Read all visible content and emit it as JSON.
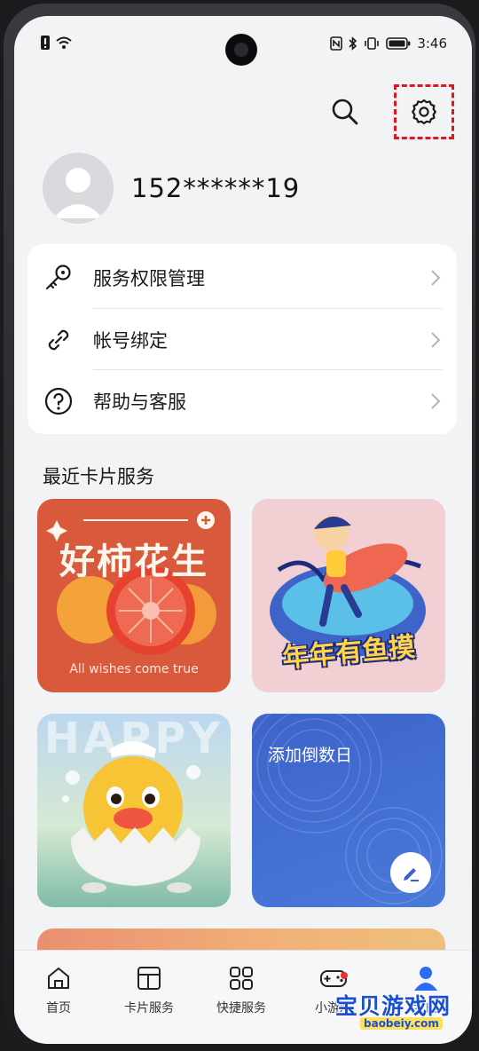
{
  "status_bar": {
    "time": "3:46"
  },
  "profile": {
    "phone_number": "152******19"
  },
  "menu": [
    {
      "label": "服务权限管理",
      "icon": "key-icon"
    },
    {
      "label": "帐号绑定",
      "icon": "link-icon"
    },
    {
      "label": "帮助与客服",
      "icon": "help-icon"
    }
  ],
  "recent_cards": {
    "title": "最近卡片服务",
    "cards": [
      {
        "title": "好柿花生",
        "subtitle": "All wishes come true"
      },
      {
        "title": "年年有鱼摸"
      },
      {
        "title": "HAPPY"
      },
      {
        "title": "添加倒数日"
      }
    ]
  },
  "bottom_nav": [
    {
      "label": "首页",
      "icon": "home-icon"
    },
    {
      "label": "卡片服务",
      "icon": "cards-icon"
    },
    {
      "label": "快捷服务",
      "icon": "grid-icon"
    },
    {
      "label": "小游戏",
      "icon": "gamepad-icon"
    },
    {
      "label": "我的",
      "icon": "person-icon",
      "active": true
    }
  ],
  "watermark": {
    "text": "宝贝游戏网",
    "url": "baobeiy.com"
  },
  "colors": {
    "accent": "#2a6cf5",
    "highlight_box": "#e0151e"
  }
}
